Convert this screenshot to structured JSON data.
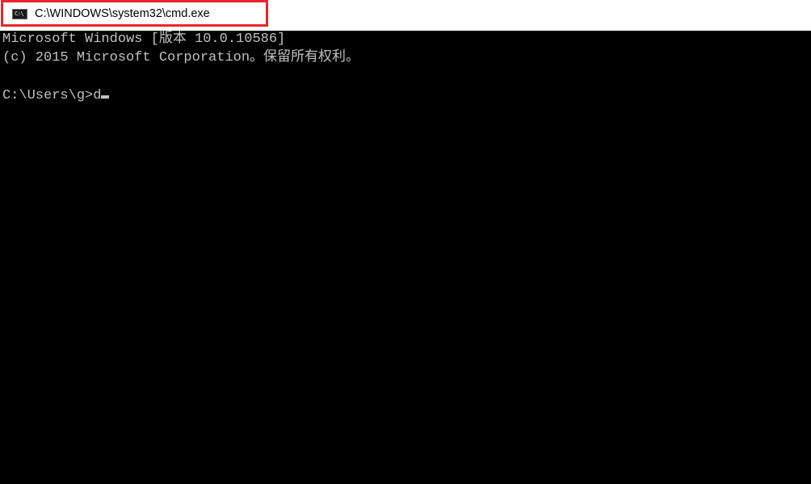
{
  "window": {
    "title": "C:\\WINDOWS\\system32\\cmd.exe",
    "icon": "console-icon",
    "icon_glyph": "C:\\",
    "highlight_color": "#e8262c"
  },
  "console": {
    "lines": [
      "Microsoft Windows [版本 10.0.10586]",
      "(c) 2015 Microsoft Corporation。保留所有权利。"
    ],
    "prompt": "C:\\Users\\g>",
    "input": "d",
    "text_color": "#c0c0c0",
    "background_color": "#000000"
  }
}
